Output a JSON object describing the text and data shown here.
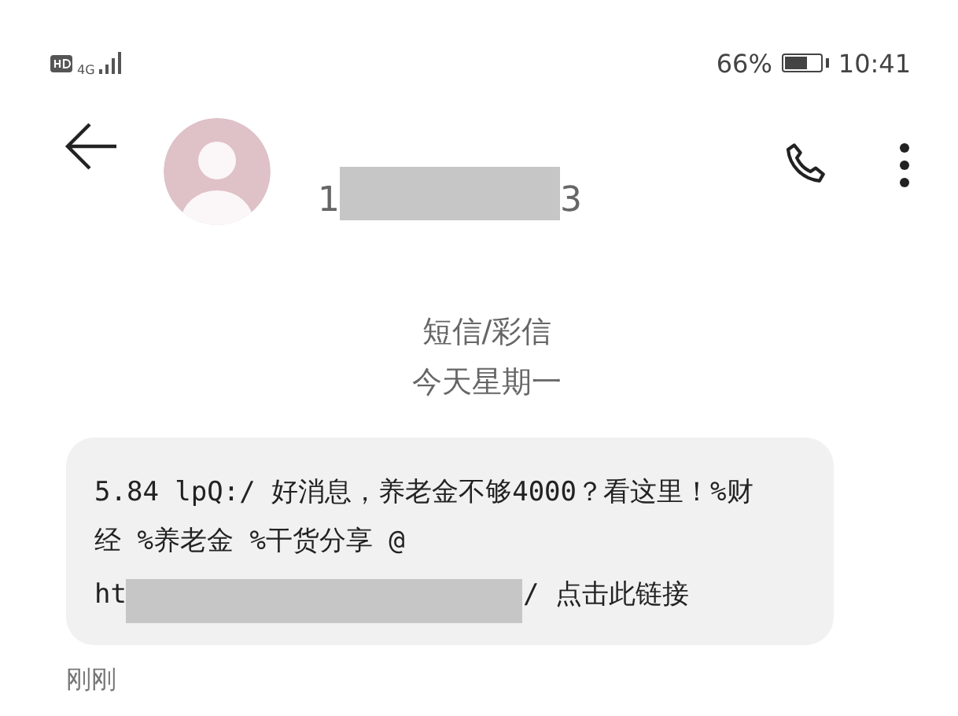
{
  "status_bar": {
    "network": "4G",
    "battery": "66%",
    "time": "10:41"
  },
  "header": {
    "number_start": "1",
    "number_end": "3"
  },
  "thread_info": {
    "type": "短信/彩信",
    "date": "今天星期一"
  },
  "message": {
    "lines": [
      "5.84 lpQ:/ 好消息，养老金不够4000？看这里！%财",
      "经 %养老金 %干货分享 @"
    ],
    "link_start": "ht",
    "link_end": "/ 点击此链接",
    "time": "刚刚"
  }
}
